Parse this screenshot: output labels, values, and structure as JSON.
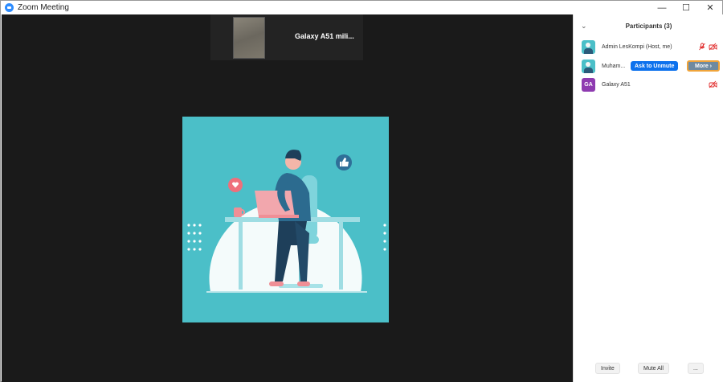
{
  "window": {
    "title": "Zoom Meeting",
    "controls": {
      "minimize": "—",
      "maximize": "☐",
      "close": "✕"
    }
  },
  "video": {
    "thumbnail_name": "Galaxy A51 mili..."
  },
  "participants": {
    "header": "Participants (3)",
    "list": [
      {
        "name": "Admin LesKompi (Host, me)",
        "avatar": "picture",
        "mic": "muted",
        "video": "off"
      },
      {
        "name": "Muham...",
        "avatar": "picture",
        "ask_label": "Ask to Unmute",
        "more_label": "More ›"
      },
      {
        "name": "Galaxy A51",
        "avatar_initials": "GA",
        "video": "off"
      }
    ],
    "footer": {
      "invite": "Invite",
      "mute_all": "Mute All",
      "more": "..."
    }
  },
  "colors": {
    "accent": "#0e72ed",
    "muted_icon": "#e02828",
    "video_bg": "#1a1a1a",
    "illustration_bg": "#4bbfc8",
    "focus_outline": "#f0a43a"
  }
}
